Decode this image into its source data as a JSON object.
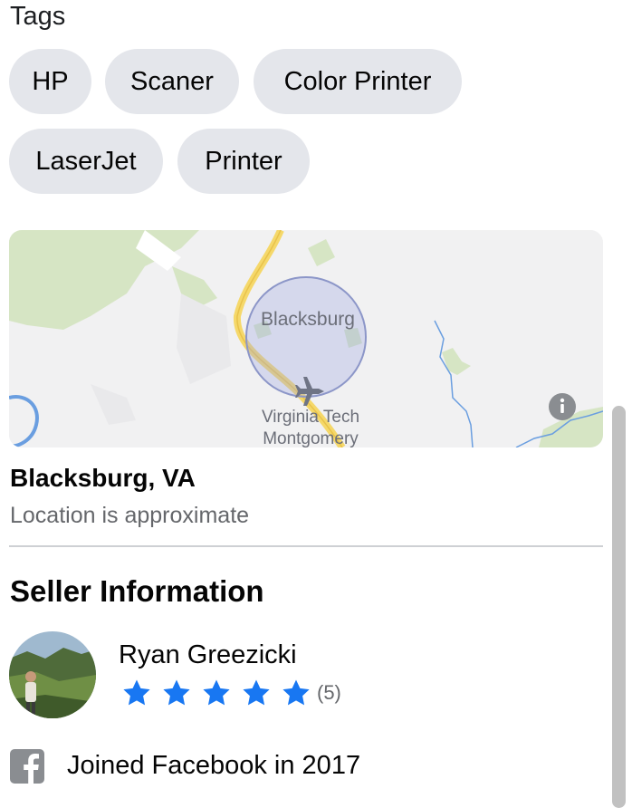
{
  "tags": {
    "title": "Tags",
    "items": [
      "HP",
      "Scaner",
      "Color Printer",
      "LaserJet",
      "Printer"
    ]
  },
  "map": {
    "city_label": "Blacksburg",
    "airport_label_line1": "Virginia Tech",
    "airport_label_line2": "Montgomery",
    "info_icon": "info-icon",
    "airport_icon": "airplane-icon"
  },
  "location": {
    "name": "Blacksburg, VA",
    "note": "Location is approximate"
  },
  "seller": {
    "section_title": "Seller Information",
    "name": "Ryan Greezicki",
    "rating_stars": 5,
    "rating_count": "(5)",
    "joined": "Joined Facebook in 2017",
    "joined_icon": "facebook-icon"
  },
  "colors": {
    "tag_bg": "#e4e6eb",
    "star": "#1877f2",
    "secondary_text": "#65676b"
  }
}
